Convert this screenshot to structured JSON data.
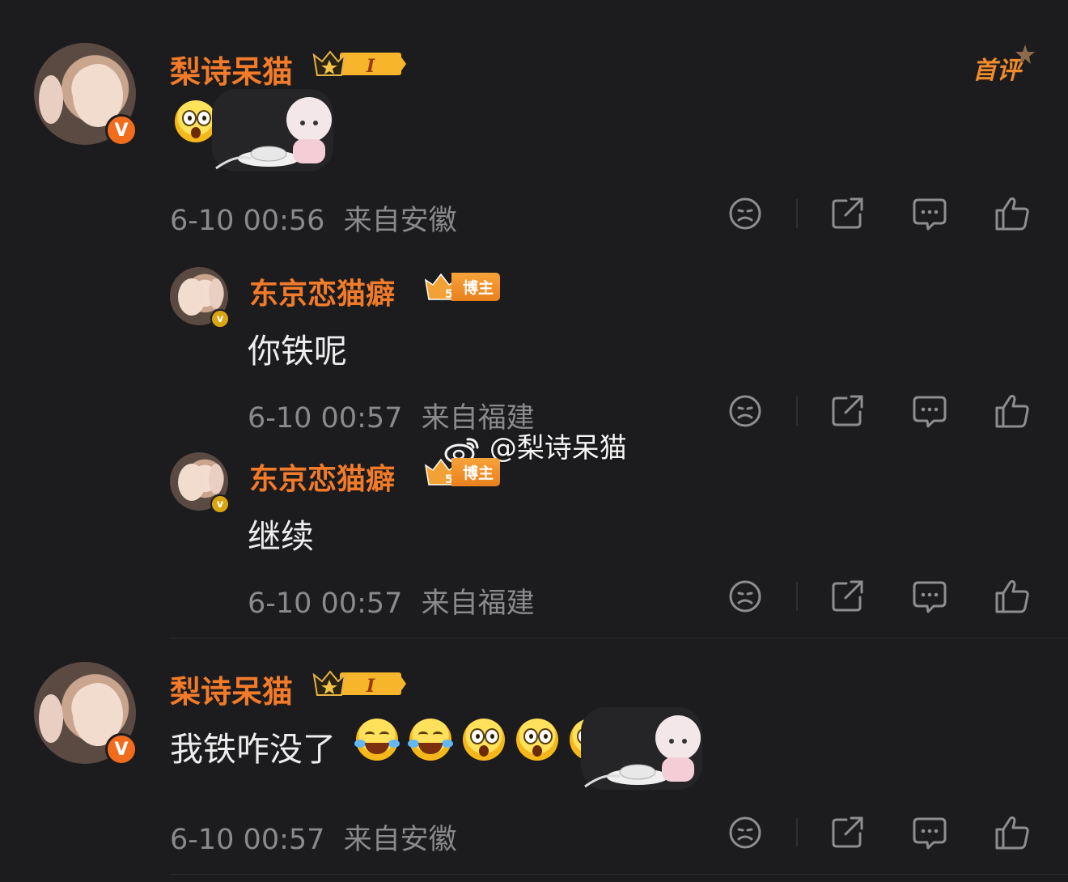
{
  "first_comment_badge": "首评",
  "watermark": "@梨诗呆猫",
  "comments": [
    {
      "author": "梨诗呆猫",
      "level": "I",
      "text": "",
      "time": "6-10 00:56",
      "location": "来自安徽"
    },
    {
      "author": "东京恋猫癖",
      "badge": "博主",
      "text": "你铁呢",
      "time": "6-10 00:57",
      "location": "来自福建"
    },
    {
      "author": "东京恋猫癖",
      "badge": "博主",
      "text": "继续",
      "time": "6-10 00:57",
      "location": "来自福建"
    },
    {
      "author": "梨诗呆猫",
      "level": "I",
      "text": "我铁咋没了",
      "time": "6-10 00:57",
      "location": "来自安徽"
    }
  ],
  "colors": {
    "background": "#1c1c1e",
    "name": "#f27b2a",
    "meta": "#8a8a8c",
    "body_text": "#ededed"
  },
  "icons": [
    "dislike-icon",
    "share-icon",
    "reply-icon",
    "like-icon",
    "verified-icon",
    "crown-icon",
    "weibo-logo-icon"
  ]
}
